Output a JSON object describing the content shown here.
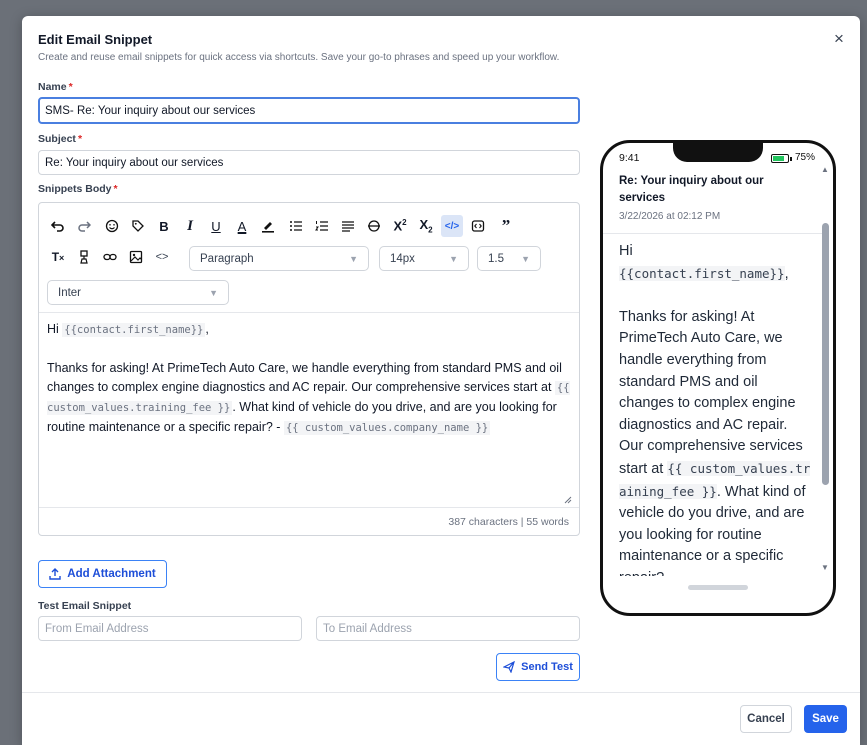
{
  "modal": {
    "title": "Edit Email Snippet",
    "subtitle": "Create and reuse email snippets for quick access via shortcuts. Save your go-to phrases and speed up your workflow.",
    "close_glyph": "×"
  },
  "form": {
    "name_label": "Name",
    "name_value": "SMS- Re: Your inquiry about our services",
    "subject_label": "Subject",
    "subject_value": "Re: Your inquiry about our services",
    "body_label": "Snippets Body",
    "required_mark": "*"
  },
  "toolbar": {
    "row1": [
      "undo-icon",
      "redo-icon",
      "emoji-icon",
      "tag-icon",
      "bold-icon",
      "italic-icon",
      "underline-icon",
      "text-color-icon",
      "highlight-icon",
      "bullet-list-icon",
      "numbered-list-icon",
      "align-icon",
      "strikethrough-icon",
      "superscript-icon",
      "subscript-icon",
      "code-view-icon",
      "embed-icon",
      "quote-icon"
    ],
    "row2": [
      "clear-format-icon",
      "format-painter-icon",
      "link-icon",
      "image-icon",
      "code-icon"
    ],
    "paragraph_select": "Paragraph",
    "size_select": "14px",
    "line_height_select": "1.5",
    "font_select": "Inter"
  },
  "body": {
    "greeting": "Hi ",
    "var_first_name": "{{contact.first_name}}",
    "after_name": ",",
    "para1_a": "Thanks for asking! At PrimeTech Auto Care, we handle everything from standard PMS and oil changes to complex engine diagnostics and AC repair. Our comprehensive services start at ",
    "var_fee": "{{ custom_values.training_fee }}",
    "para1_b": ". What kind of vehicle do you drive, and are you looking for routine maintenance or a specific repair? - ",
    "var_company": "{{ custom_values.company_name }}"
  },
  "counter": "387 characters | 55 words",
  "attachment_button": "Add Attachment",
  "test": {
    "label": "Test Email Snippet",
    "from_placeholder": "From Email Address",
    "to_placeholder": "To Email Address",
    "send_button": "Send Test"
  },
  "footer": {
    "cancel": "Cancel",
    "save": "Save"
  },
  "phone": {
    "time": "9:41",
    "battery": "75%",
    "subject": "Re: Your inquiry about our services",
    "date": "3/22/2026 at 02:12 PM",
    "greeting": "Hi",
    "var_first_name": "{{contact.first_name}}",
    "after_name": ",",
    "para_a": "Thanks for asking! At PrimeTech Auto Care, we handle everything from standard PMS and oil changes to complex engine diagnostics and AC repair. Our comprehensive services start at ",
    "var_fee": "{{ custom_values.training_fee }}",
    "para_b": ". What kind of vehicle do you drive, and are you looking for routine maintenance or a specific repair?"
  },
  "colors": {
    "primary": "#2563eb",
    "focus_border": "#4a7fe0",
    "required": "#dc2626",
    "battery": "#22c55e"
  }
}
